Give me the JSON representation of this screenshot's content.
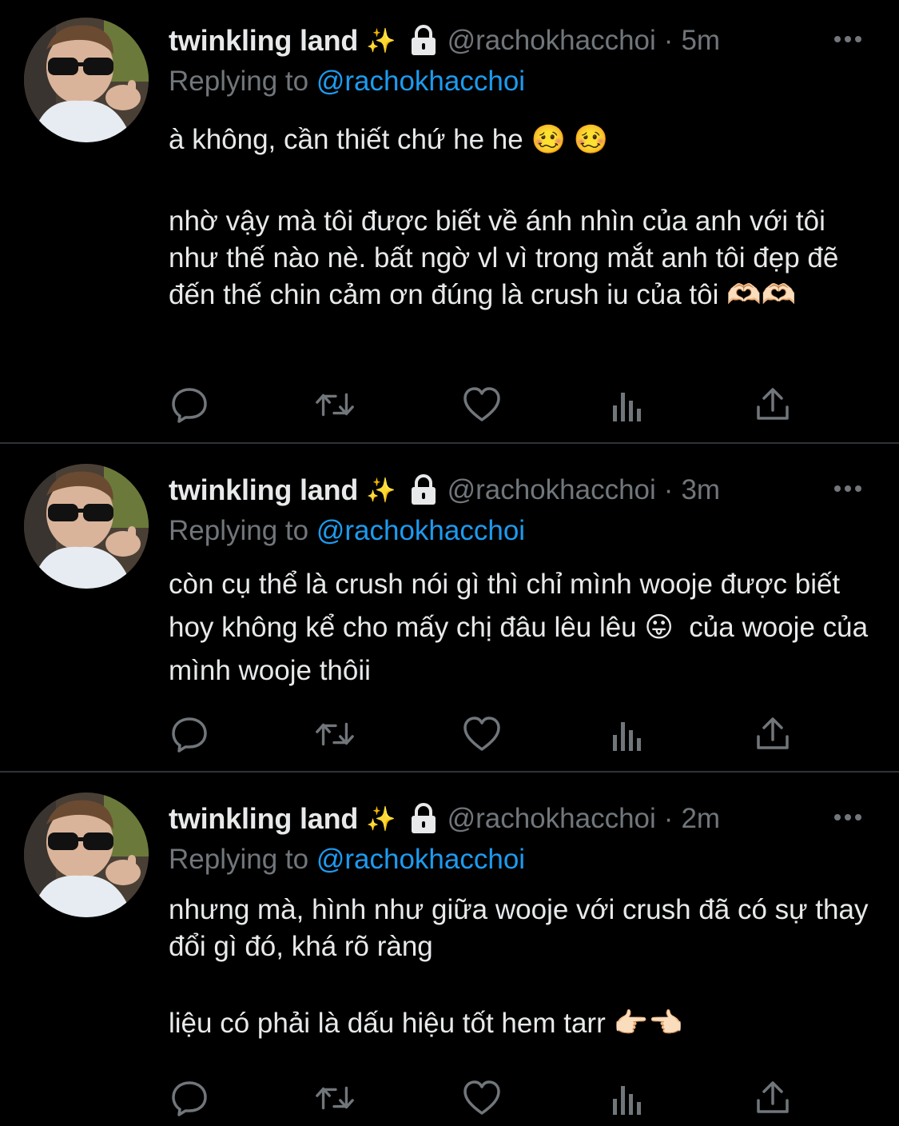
{
  "tweets": [
    {
      "display_name": "twinkling land",
      "sparkle": "✨",
      "handle": "@rachokhacchoi",
      "dot": "·",
      "time": "5m",
      "reply_prefix": "Replying to",
      "reply_to": "@rachokhacchoi",
      "body": [
        "à không, cần thiết chứ he he 🥴 🥴",
        "",
        "nhờ vậy mà tôi được biết về ánh nhìn của anh với tôi như thế nào nè. bất ngờ vl vì trong mắt anh tôi đẹp đẽ đến thế chin cảm ơn đúng là crush iu của tôi 🫶🏻🫶🏻"
      ]
    },
    {
      "display_name": "twinkling land",
      "sparkle": "✨",
      "handle": "@rachokhacchoi",
      "dot": "·",
      "time": "3m",
      "reply_prefix": "Replying to",
      "reply_to": "@rachokhacchoi",
      "body": [
        "còn cụ thể là crush nói gì thì chỉ mình wooje được biết hoy không kể cho mấy chị đâu lêu lêu 😛  của wooje của mình wooje thôii"
      ]
    },
    {
      "display_name": "twinkling land",
      "sparkle": "✨",
      "handle": "@rachokhacchoi",
      "dot": "·",
      "time": "2m",
      "reply_prefix": "Replying to",
      "reply_to": "@rachokhacchoi",
      "body": [
        "nhưng mà, hình như giữa wooje với crush đã có sự thay đổi gì đó, khá rõ ràng",
        "",
        "liệu có phải là dấu hiệu tốt hem tarr 👉🏻👈🏻"
      ]
    }
  ],
  "icons": {
    "reply": "comment-bubble-icon",
    "retweet": "retweet-icon",
    "like": "heart-icon",
    "views": "analytics-bars-icon",
    "share": "share-upload-icon",
    "more": "more-dots-icon",
    "lock": "lock-icon"
  },
  "colors": {
    "background": "#000000",
    "text": "#e7e9ea",
    "secondary": "#71767b",
    "link": "#1d9bf0",
    "separator": "#2f3336"
  }
}
